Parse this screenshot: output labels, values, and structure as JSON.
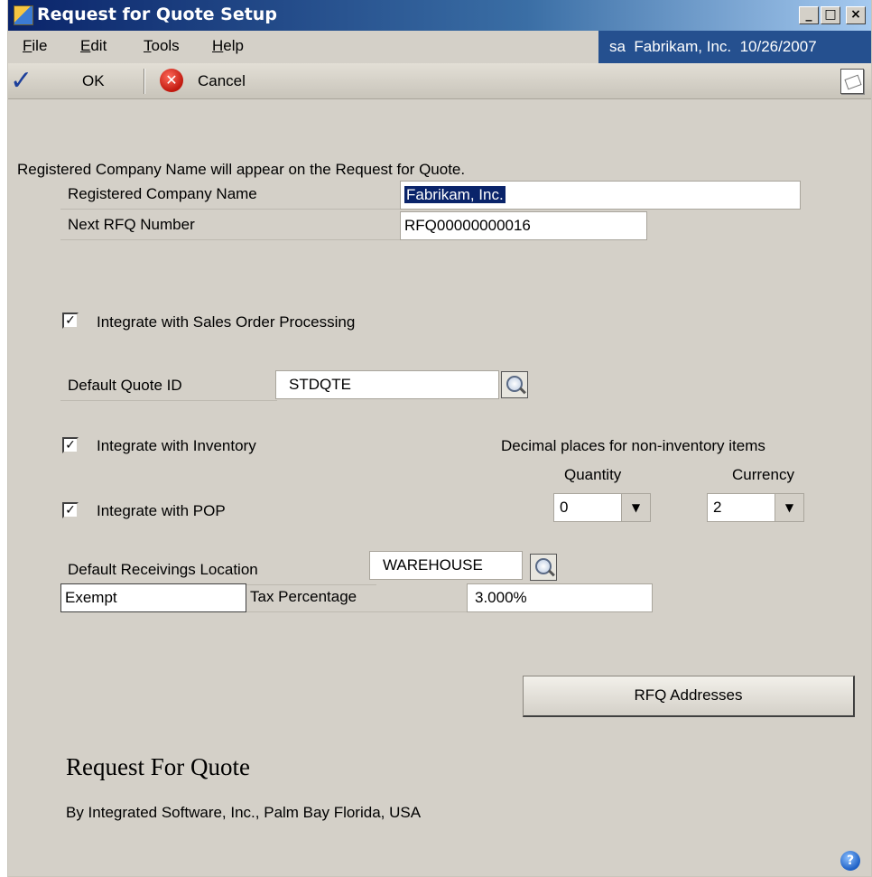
{
  "window": {
    "title": "Request for Quote Setup",
    "minimize_glyph": "_",
    "maximize_glyph": "□",
    "close_glyph": "×"
  },
  "menu": {
    "file": {
      "accel": "F",
      "rest": "ile"
    },
    "edit": {
      "accel": "E",
      "rest": "dit"
    },
    "tools": {
      "accel": "T",
      "rest": "ools"
    },
    "help": {
      "accel": "H",
      "rest": "elp"
    }
  },
  "status": {
    "user": "sa",
    "company": "Fabrikam, Inc.",
    "date": "10/26/2007"
  },
  "toolbar": {
    "ok_label": "OK",
    "cancel_label": "Cancel",
    "ok_glyph": "✓",
    "cancel_glyph": "✕"
  },
  "form": {
    "intro_text": "Registered Company Name will appear on the Request for Quote.",
    "registered_company_label": "Registered Company Name",
    "registered_company_value": "Fabrikam, Inc.",
    "next_rfq_label": "Next RFQ Number",
    "next_rfq_value": "RFQ00000000016",
    "integrate_sop_label": "Integrate with Sales Order Processing",
    "integrate_sop_checked": true,
    "default_quote_label": "Default Quote ID",
    "default_quote_value": "STDQTE",
    "integrate_inventory_label": "Integrate with Inventory",
    "integrate_inventory_checked": true,
    "integrate_pop_label": "Integrate with  POP",
    "integrate_pop_checked": true,
    "decimal_heading": "Decimal places for non-inventory items",
    "quantity_label": "Quantity",
    "quantity_value": "0",
    "currency_label": "Currency",
    "currency_value": "2",
    "receivings_label": "Default Receivings Location",
    "receivings_value": "WAREHOUSE",
    "tax_code_value": "Exempt",
    "tax_percentage_label": "Tax Percentage",
    "tax_percentage_value": "3.000%",
    "rfq_addresses_button": "RFQ  Addresses",
    "check_glyph": "✓",
    "dropdown_glyph": "▼"
  },
  "branding": {
    "product_title": "Request For Quote",
    "publisher": "By Integrated Software, Inc., Palm Bay Florida, USA",
    "help_glyph": "?"
  }
}
